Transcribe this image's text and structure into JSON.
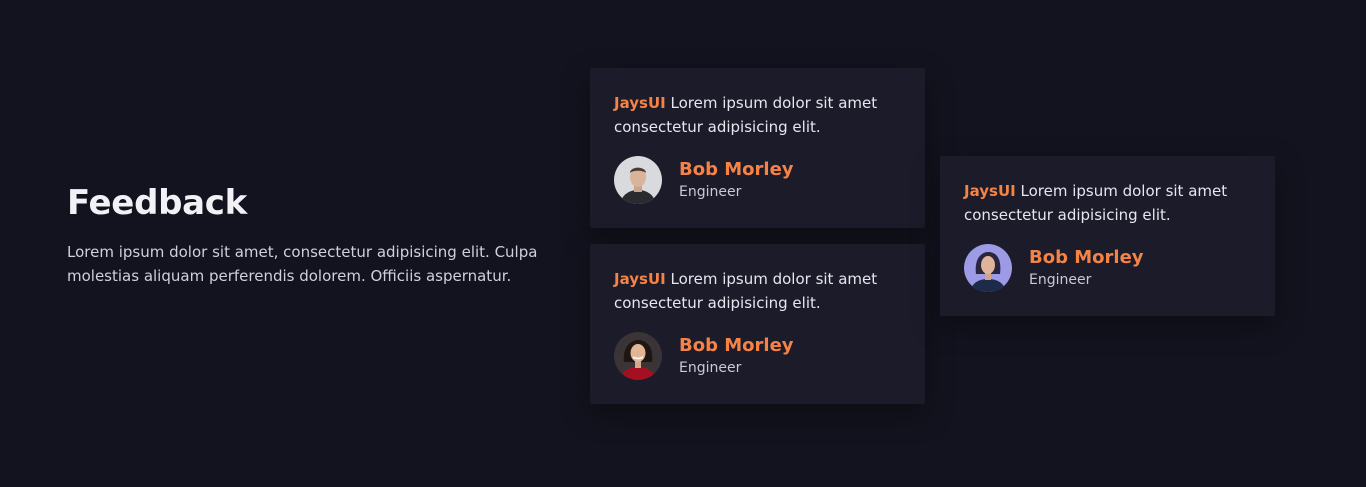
{
  "section": {
    "title": "Feedback",
    "description": "Lorem ipsum dolor sit amet, consectetur adipisicing elit. Culpa molestias aliquam perferendis dolorem. Officiis aspernatur."
  },
  "colors": {
    "background": "#13131f",
    "card": "#1b1b29",
    "accent": "#f58346"
  },
  "testimonials": [
    {
      "brand": "JaysUI",
      "quote": " Lorem ipsum dolor sit amet consectetur adipisicing elit.",
      "name": "Bob Morley",
      "role": "Engineer",
      "avatar": "man-avatar"
    },
    {
      "brand": "JaysUI",
      "quote": " Lorem ipsum dolor sit amet consectetur adipisicing elit.",
      "name": "Bob Morley",
      "role": "Engineer",
      "avatar": "woman-red-avatar"
    },
    {
      "brand": "JaysUI",
      "quote": " Lorem ipsum dolor sit amet consectetur adipisicing elit.",
      "name": "Bob Morley",
      "role": "Engineer",
      "avatar": "woman-purple-avatar"
    }
  ]
}
